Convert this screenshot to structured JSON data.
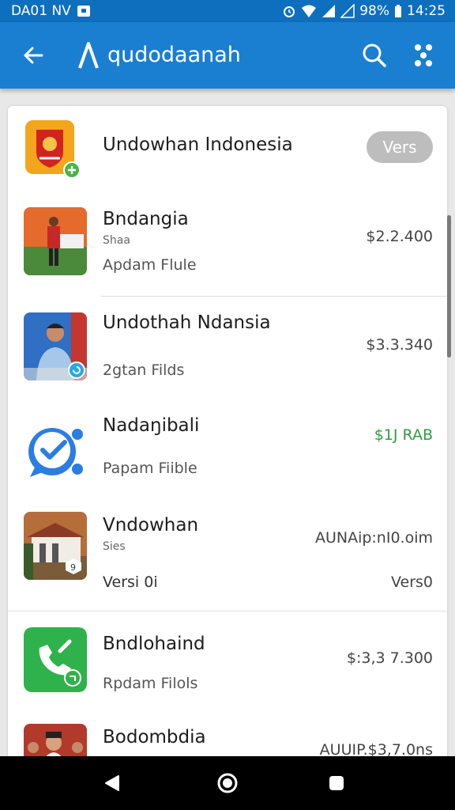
{
  "status_bar": {
    "left_text": "DA01 NV",
    "battery": "98%",
    "time": "14:25"
  },
  "app_bar": {
    "title": "qudodaanah",
    "icons": [
      "back-arrow-icon",
      "app-logo-icon",
      "search-icon",
      "more-icon"
    ]
  },
  "items": [
    {
      "name": "Undowhan Indonesia",
      "small": "",
      "subtitle": "",
      "price": "",
      "action_label": "Vers",
      "icon": "coat-of-arms-icon"
    },
    {
      "name": "Bndangia",
      "small": "Shaa",
      "subtitle": "Apdam Flule",
      "price": "$2.2.400",
      "icon": "photo-thumbnail-icon"
    },
    {
      "name": "Undothah Ndansia",
      "small": "",
      "subtitle": "2gtan Filds",
      "price": "$3.3.340",
      "icon": "person-thumbnail-icon"
    },
    {
      "name": "Nadaŋibali",
      "small": "",
      "subtitle": "Papam Fiible",
      "price": "$1J RAB",
      "price_color": "#2e9e3e",
      "icon": "checkmark-chat-icon"
    },
    {
      "name": "Vndowhan",
      "small": "Sies",
      "subtitle": "Versi 0i",
      "price": "AUNAip:nI0.oim",
      "right_sub": "Vers0",
      "icon": "building-thumbnail-icon"
    },
    {
      "name": "Bndlohaind",
      "small": "",
      "subtitle": "Rpdam Filols",
      "price": "$:3,3 7.300",
      "icon": "phone-call-icon"
    },
    {
      "name": "Bodombdia",
      "small": "",
      "subtitle": "",
      "price": "AUUIP.$3,7.0ns",
      "icon": "people-thumbnail-icon"
    }
  ],
  "nav_bar": {
    "icons": [
      "nav-back-icon",
      "nav-home-icon",
      "nav-recents-icon"
    ]
  },
  "colors": {
    "status_bar": "#0f6fbf",
    "app_bar": "#1a7fd0",
    "price_green": "#2e9e3e"
  }
}
